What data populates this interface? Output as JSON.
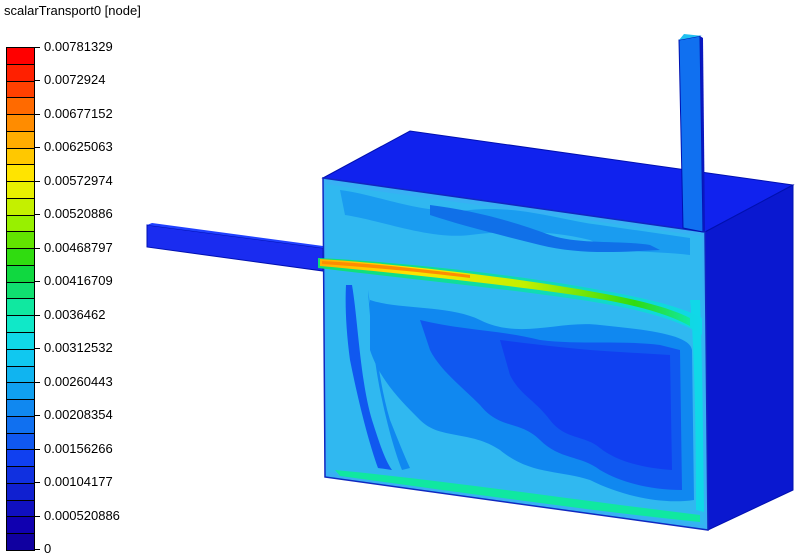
{
  "legend": {
    "title": "scalarTransport0 [node]",
    "labels": [
      "0.00781329",
      "0.0072924",
      "0.00677152",
      "0.00625063",
      "0.00572974",
      "0.00520886",
      "0.00468797",
      "0.00416709",
      "0.0036462",
      "0.00312532",
      "0.00260443",
      "0.00208354",
      "0.00156266",
      "0.00104177",
      "0.000520886",
      "0"
    ],
    "colors": [
      "#ff0000",
      "#ff2000",
      "#ff4000",
      "#ff6a00",
      "#ff8c00",
      "#ffac00",
      "#ffc800",
      "#ffe400",
      "#e8f000",
      "#c4f000",
      "#98f000",
      "#62e400",
      "#30dc10",
      "#10d840",
      "#10e070",
      "#10e8a0",
      "#10e8c8",
      "#10d8e8",
      "#10c8f0",
      "#10b4f0",
      "#10a0f0",
      "#1088f0",
      "#1070f0",
      "#1058f0",
      "#1040f0",
      "#1030e0",
      "#1020d0",
      "#1010c0",
      "#1000b0",
      "#1000a0"
    ]
  }
}
